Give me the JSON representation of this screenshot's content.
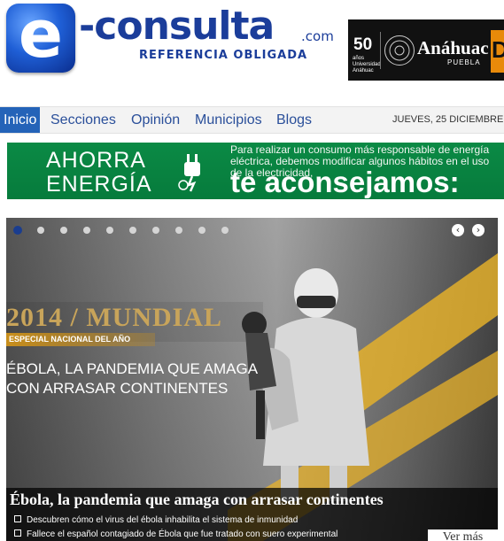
{
  "header": {
    "logo_letter": "e",
    "logo_word": "-consulta",
    "logo_domain": ".com",
    "tagline": "REFERENCIA OBLIGADA"
  },
  "ad": {
    "badge_number": "50",
    "badge_sub": "años Universidad Anáhuac",
    "name": "Anáhuac",
    "city": "PUEBLA",
    "partial_letter": "D",
    "colors": {
      "background": "#111111",
      "accent": "#e88a0a"
    }
  },
  "nav": {
    "items": [
      {
        "label": "Inicio",
        "active": true
      },
      {
        "label": "Secciones",
        "active": false
      },
      {
        "label": "Opinión",
        "active": false
      },
      {
        "label": "Municipios",
        "active": false
      },
      {
        "label": "Blogs",
        "active": false
      }
    ],
    "date": "JUEVES, 25 DICIEMBRE",
    "colors": {
      "active_bg": "#2463b8",
      "link": "#2a4f9a"
    }
  },
  "banner": {
    "line1": "AHORRA",
    "line2": "ENERGÍA",
    "message": "Para realizar un consumo más responsable de energía eléctrica, debemos modificar algunos hábitos en el uso de la electricidad,",
    "big_text": "te aconsejamos:",
    "icon": "plug-icon",
    "colors": {
      "background": "#0b8a45"
    }
  },
  "slider": {
    "dot_count": 10,
    "active_dot": 0,
    "prev_icon": "chevron-left-icon",
    "next_icon": "chevron-right-icon",
    "year_title": "2014 / MUNDIAL",
    "special_label": "ESPECIAL NACIONAL DEL AÑO",
    "headline_line1": "ÉBOLA, LA PANDEMIA QUE AMAGA",
    "headline_line2": "CON ARRASAR CONTINENTES",
    "caption_title": "Ébola, la pandemia que amaga con arrasar continentes",
    "caption_items": [
      "Descubren cómo el virus del ébola inhabilita el sistema de inmunidad",
      "Fallece el español contagiado de Ébola que fue tratado con suero experimental"
    ],
    "more_label": "Ver más",
    "colors": {
      "stripe": "#e8b22a",
      "gold_title": "#c8a45a"
    }
  }
}
